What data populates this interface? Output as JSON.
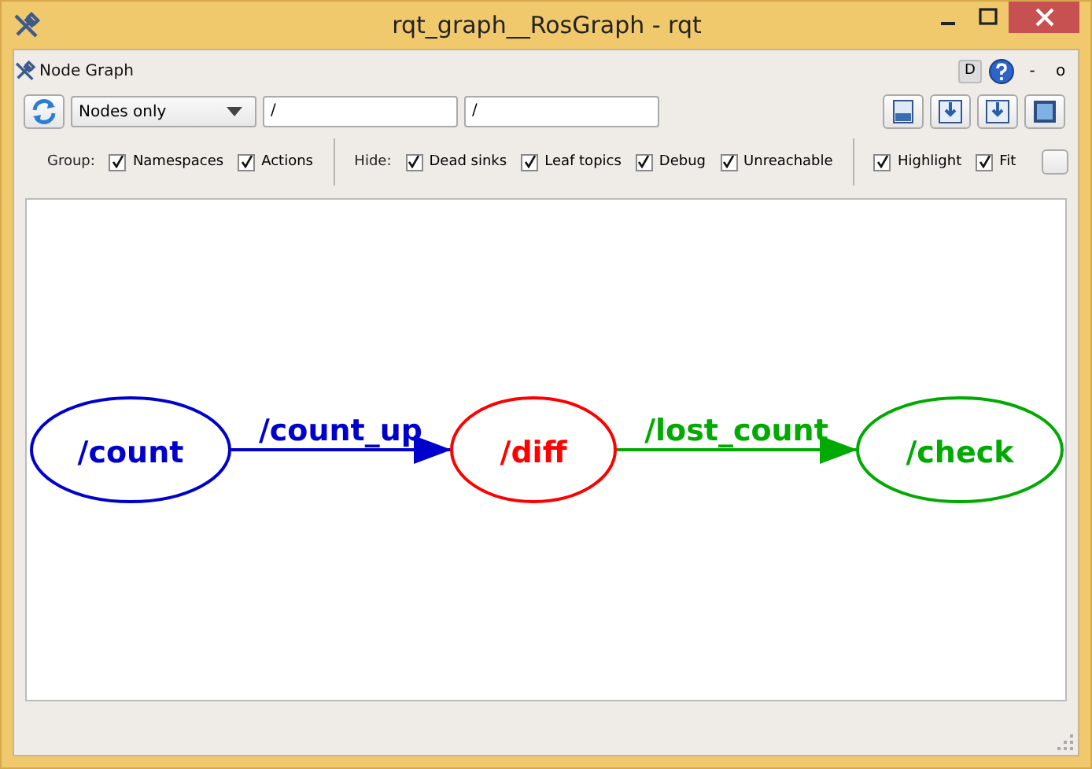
{
  "window": {
    "title": "rqt_graph__RosGraph - rqt"
  },
  "plugin": {
    "title": "Node Graph",
    "help_buttons": [
      "D"
    ],
    "dock_controls": [
      "-",
      "o"
    ]
  },
  "toolbar": {
    "mode": "Nodes only",
    "filter_1": "/",
    "filter_2": "/"
  },
  "option_groups": [
    {
      "label": "Group:",
      "options": [
        {
          "label": "Namespaces",
          "checked": true
        },
        {
          "label": "Actions",
          "checked": true
        }
      ]
    },
    {
      "label": "Hide:",
      "options": [
        {
          "label": "Dead sinks",
          "checked": true
        },
        {
          "label": "Leaf topics",
          "checked": true
        },
        {
          "label": "Debug",
          "checked": true
        },
        {
          "label": "Unreachable",
          "checked": true
        }
      ]
    },
    {
      "options": [
        {
          "label": "Highlight",
          "checked": true
        },
        {
          "label": "Fit",
          "checked": true
        }
      ]
    }
  ],
  "graph": {
    "nodes": [
      {
        "label": "/count",
        "color": "#0000cc"
      },
      {
        "label": "/diff",
        "color": "#ff0000"
      },
      {
        "label": "/check",
        "color": "#00aa00"
      }
    ],
    "edges": [
      {
        "label": "/count_up",
        "color": "#0000cc"
      },
      {
        "label": "/lost_count",
        "color": "#00aa00"
      }
    ]
  }
}
